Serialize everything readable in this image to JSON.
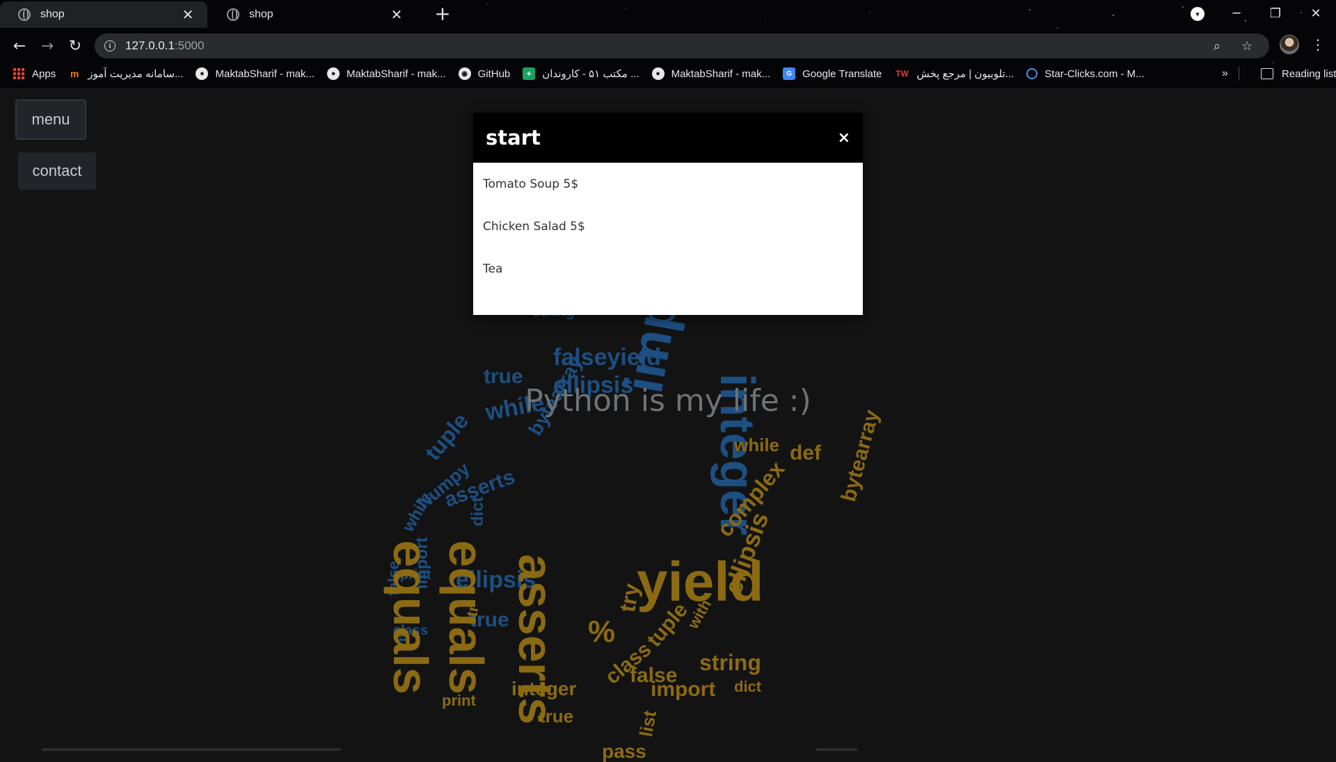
{
  "tabs": [
    {
      "title": "shop",
      "active": true
    },
    {
      "title": "shop",
      "active": false
    }
  ],
  "new_tab_label": "+",
  "address_bar": {
    "host": "127.0.0.1",
    "port": ":5000"
  },
  "bookmarks": [
    {
      "label": "Apps",
      "icon": "apps-grid-icon"
    },
    {
      "label": "سامانه مدیریت آموز...",
      "icon": "maktab-logo-icon"
    },
    {
      "label": "MaktabSharif - mak...",
      "icon": "person-icon"
    },
    {
      "label": "MaktabSharif - mak...",
      "icon": "person-icon"
    },
    {
      "label": "GitHub",
      "icon": "github-icon"
    },
    {
      "label": "مکتب ۵۱ - کاروندان ...",
      "icon": "green-plus-icon"
    },
    {
      "label": "MaktabSharif - mak...",
      "icon": "person-icon"
    },
    {
      "label": "Google Translate",
      "icon": "google-translate-icon"
    },
    {
      "label": "تلوبیون | مرجع پخش...",
      "icon": "telewebion-icon"
    },
    {
      "label": "Star-Clicks.com - M...",
      "icon": "star-clicks-icon"
    }
  ],
  "bookmarks_overflow": "»",
  "reading_list": "Reading list",
  "sidebar": {
    "menu_label": "menu",
    "contact_label": "contact"
  },
  "hero_text": "Python is my life :)",
  "modal": {
    "title": "start",
    "close_label": "×",
    "items": [
      "Tomato Soup 5$",
      "Chicken Salad 5$",
      "Tea"
    ]
  },
  "colors": {
    "cloud_blue": "#1d4f82",
    "cloud_yellow": "#8b6a12",
    "modal_header": "#000000",
    "page_bg": "#131313"
  },
  "word_cloud": [
    {
      "t": "import",
      "c": "b"
    },
    {
      "t": "integer",
      "c": "b"
    },
    {
      "t": "falseyield",
      "c": "b"
    },
    {
      "t": "ellipsis",
      "c": "b"
    },
    {
      "t": "true",
      "c": "b"
    },
    {
      "t": "string",
      "c": "b"
    },
    {
      "t": "while",
      "c": "b"
    },
    {
      "t": "tuple",
      "c": "b"
    },
    {
      "t": "Numpy",
      "c": "b"
    },
    {
      "t": "bytearray",
      "c": "b"
    },
    {
      "t": "asserts",
      "c": "b"
    },
    {
      "t": "while",
      "c": "b"
    },
    {
      "t": "dict",
      "c": "b"
    },
    {
      "t": "import",
      "c": "b"
    },
    {
      "t": "ellipsis",
      "c": "b"
    },
    {
      "t": "true",
      "c": "b"
    },
    {
      "t": "int",
      "c": "b"
    },
    {
      "t": "false",
      "c": "b"
    },
    {
      "t": "class",
      "c": "b"
    },
    {
      "t": "print",
      "c": "b"
    },
    {
      "t": "yield",
      "c": "y"
    },
    {
      "t": "equals",
      "c": "y"
    },
    {
      "t": "asserts",
      "c": "y"
    },
    {
      "t": "import",
      "c": "y"
    },
    {
      "t": "string",
      "c": "y"
    },
    {
      "t": "integer",
      "c": "y"
    },
    {
      "t": "complex",
      "c": "y"
    },
    {
      "t": "ellipsis",
      "c": "y"
    },
    {
      "t": "try",
      "c": "y"
    },
    {
      "t": "%",
      "c": "y"
    },
    {
      "t": "false",
      "c": "y"
    },
    {
      "t": "class",
      "c": "y"
    },
    {
      "t": "tuple",
      "c": "y"
    },
    {
      "t": "pass",
      "c": "y"
    },
    {
      "t": "list",
      "c": "y"
    },
    {
      "t": "equals",
      "c": "y"
    },
    {
      "t": "true",
      "c": "y"
    },
    {
      "t": "bytearray",
      "c": "y"
    },
    {
      "t": "def",
      "c": "y"
    },
    {
      "t": "while",
      "c": "y"
    },
    {
      "t": "with",
      "c": "y"
    },
    {
      "t": "print",
      "c": "y"
    },
    {
      "t": "dict",
      "c": "y"
    },
    {
      "t": "str",
      "c": "y"
    }
  ]
}
